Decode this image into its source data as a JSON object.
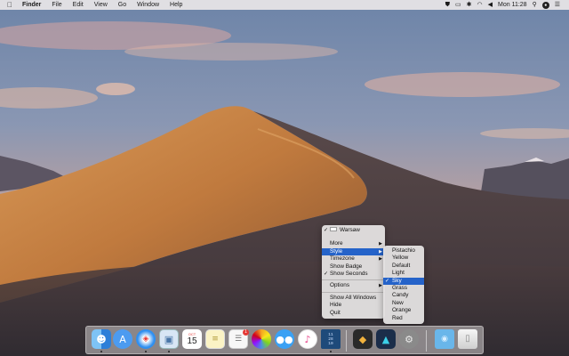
{
  "menubar": {
    "apple_glyph": "",
    "app_name": "Finder",
    "items": [
      "File",
      "Edit",
      "View",
      "Go",
      "Window",
      "Help"
    ],
    "clock": "Mon 11:28",
    "status_icons": [
      "shield-icon",
      "airplay-icon",
      "bluetooth-icon",
      "wifi-icon",
      "volume-icon",
      "spotlight-icon",
      "user-icon",
      "notification-icon"
    ]
  },
  "main_menu": {
    "clock_item": "Warsaw",
    "items": [
      {
        "label": "More",
        "submenu": true
      },
      {
        "label": "Style",
        "submenu": true,
        "selected": true
      },
      {
        "label": "Timezone",
        "submenu": true
      },
      {
        "label": "Show Badge"
      },
      {
        "label": "Show Seconds",
        "checked": true
      },
      {
        "label": "Options",
        "submenu": true
      },
      {
        "label": "Show All Windows"
      },
      {
        "label": "Hide"
      },
      {
        "label": "Quit"
      }
    ]
  },
  "style_menu": {
    "items": [
      {
        "label": "Pistachio"
      },
      {
        "label": "Yellow"
      },
      {
        "label": "Default"
      },
      {
        "label": "Light"
      },
      {
        "label": "Sky",
        "checked": true,
        "selected": true
      },
      {
        "label": "Grass"
      },
      {
        "label": "Candy"
      },
      {
        "label": "New"
      },
      {
        "label": "Orange"
      },
      {
        "label": "Red"
      }
    ]
  },
  "dock": {
    "calendar": {
      "month": "OCT",
      "day": "15"
    },
    "reminders_badge": "1",
    "clock_app": {
      "lines": [
        "11",
        "28",
        "10"
      ]
    },
    "apps": [
      {
        "name": "finder-icon",
        "color": "#3d8fe0",
        "running": true
      },
      {
        "name": "launchpad-icon",
        "color": "#5aa2f0",
        "running": false
      },
      {
        "name": "safari-icon",
        "color": "#2f8ff0",
        "running": true
      },
      {
        "name": "mail-photo-icon",
        "color": "#5b86b5",
        "running": true
      },
      {
        "name": "calendar-icon",
        "color": "#ffffff",
        "running": false
      },
      {
        "name": "notes-icon",
        "color": "#f7e58a",
        "running": false
      },
      {
        "name": "reminders-icon",
        "color": "#f4f4f4",
        "running": false
      },
      {
        "name": "photos-icon",
        "color": "#ffffff",
        "running": false
      },
      {
        "name": "messages-icon",
        "color": "#3aa1f4",
        "running": false
      },
      {
        "name": "itunes-icon",
        "color": "#ffffff",
        "running": false
      },
      {
        "name": "clock-app-icon",
        "color": "#1e4a7a",
        "running": true
      },
      {
        "name": "sketch-icon",
        "color": "#2a2a2a",
        "running": false
      },
      {
        "name": "affinity-icon",
        "color": "#1b2d4a",
        "running": false
      },
      {
        "name": "system-preferences-icon",
        "color": "#888888",
        "running": false
      },
      {
        "name": "folder-icon",
        "color": "#69b6ea",
        "running": false
      },
      {
        "name": "trash-icon",
        "color": "#e8e8e8",
        "running": false
      }
    ]
  },
  "colors": {
    "accent": "#2563c9",
    "menu_bg": "#e2e0e0"
  }
}
